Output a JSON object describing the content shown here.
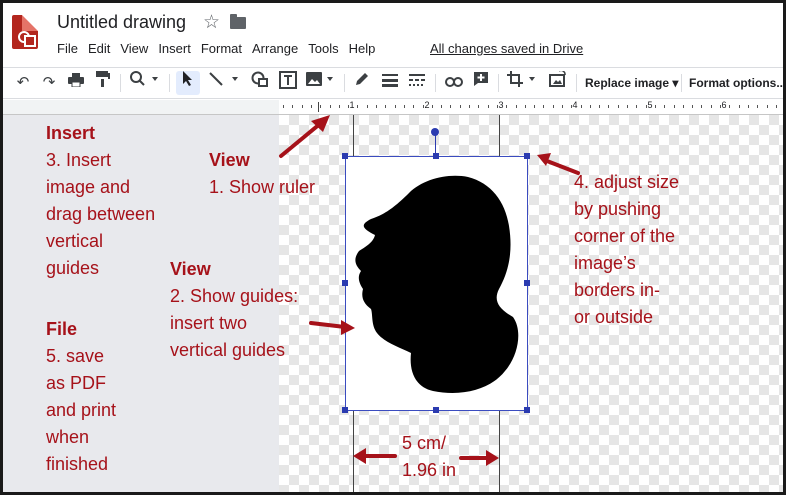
{
  "app": {
    "title": "Untitled drawing",
    "save_status": "All changes saved in Drive",
    "menus": [
      "File",
      "Edit",
      "View",
      "Insert",
      "Format",
      "Arrange",
      "Tools",
      "Help"
    ]
  },
  "toolbar": {
    "replace_image": "Replace image",
    "format_options": "Format options..."
  },
  "ruler": {
    "marks": [
      "1",
      "2",
      "3",
      "4",
      "5",
      "6"
    ]
  },
  "annotations": {
    "insert_heading": "Insert",
    "insert_lines": [
      "3. Insert",
      "image and",
      "drag between",
      "vertical",
      "guides"
    ],
    "file_heading": "File",
    "file_lines": [
      "5. save",
      "as PDF",
      "and print",
      "when",
      "finished"
    ],
    "view1_heading": "View",
    "view1_line": "1. Show ruler",
    "view2_heading": "View",
    "view2_lines": [
      "2. Show guides:",
      "insert two",
      "vertical guides"
    ],
    "resize_lines": [
      "4. adjust size",
      "by pushing",
      "corner of the",
      "image’s",
      "borders in-",
      "or outside"
    ],
    "size_lines": [
      "5 cm/",
      "1.96 in"
    ]
  },
  "colors": {
    "annotation": "#a6121a",
    "selection": "#2b3bb0",
    "brand": "#b3261e"
  }
}
